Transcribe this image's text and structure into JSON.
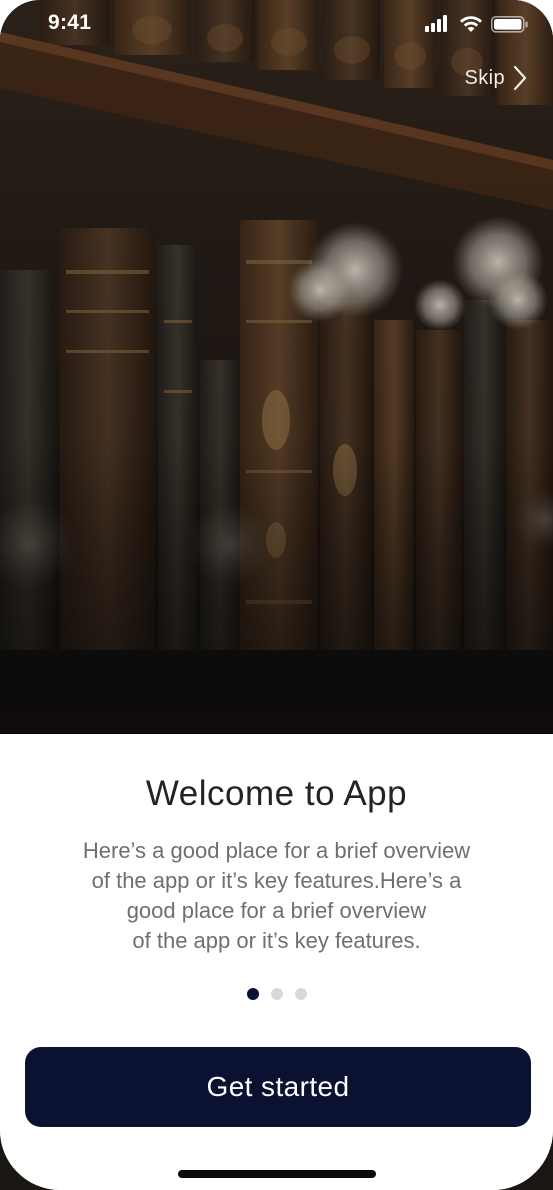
{
  "status_bar": {
    "time": "9:41",
    "icons": [
      "signal-icon",
      "wifi-icon",
      "battery-icon"
    ]
  },
  "header": {
    "skip_label": "Skip",
    "skip_icon": "chevron-right-icon"
  },
  "hero": {
    "image": "bookshelf-photo"
  },
  "onboarding": {
    "title": "Welcome to App",
    "description_lines": [
      "Here’s a good place for a brief overview",
      "of the app or it’s key features.Here’s a",
      "good place for a brief overview",
      "of the app or it’s key features."
    ],
    "pagination": {
      "current": 1,
      "total": 3
    },
    "cta_label": "Get started"
  },
  "colors": {
    "primary": "#0b1130",
    "title": "#232323",
    "body_text": "#6f6f6f",
    "dot_inactive": "#d9d9dc",
    "background": "#ffffff"
  }
}
